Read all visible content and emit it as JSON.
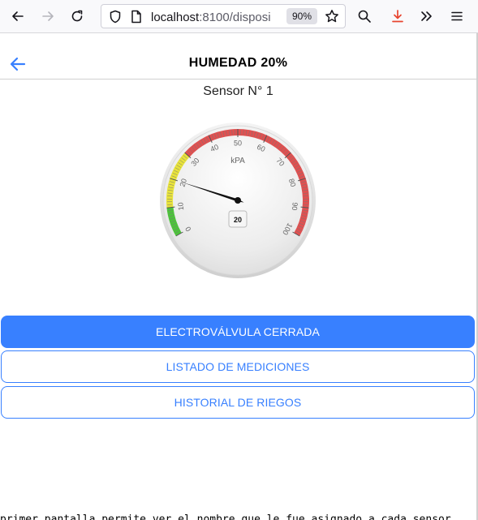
{
  "browser": {
    "url_host": "localhost",
    "url_rest": ":8100/disposi",
    "zoom": "90%",
    "icons": [
      "back-arrow-icon",
      "forward-arrow-icon",
      "reload-icon",
      "shield-icon",
      "page-icon",
      "star-icon",
      "search-icon",
      "download-icon",
      "overflow-chevrons-icon",
      "hamburger-menu-icon"
    ]
  },
  "header": {
    "title": "HUMEDAD 20%",
    "back_icon": "arrow-left-icon"
  },
  "sensor": {
    "label": "Sensor N° 1"
  },
  "gauge": {
    "unit": "kPA",
    "min": 0,
    "max": 100,
    "value": 20,
    "value_display": "20",
    "tick_labels": [
      "0",
      "10",
      "20",
      "30",
      "40",
      "50",
      "60",
      "70",
      "80",
      "90",
      "100"
    ],
    "zones": [
      {
        "from": 0,
        "to": 10,
        "color": "#4cc43a"
      },
      {
        "from": 10,
        "to": 30,
        "color": "#e8e33a"
      },
      {
        "from": 30,
        "to": 100,
        "color": "#e05050"
      }
    ]
  },
  "buttons": {
    "valve": "ELECTROVÁLVULA CERRADA",
    "list": "LISTADO DE MEDICIONES",
    "history": "HISTORIAL DE RIEGOS"
  },
  "colors": {
    "primary": "#3880ff"
  },
  "footer_text": "primer pantalla permite ver el nombre que le fue asignado a cada sensor"
}
